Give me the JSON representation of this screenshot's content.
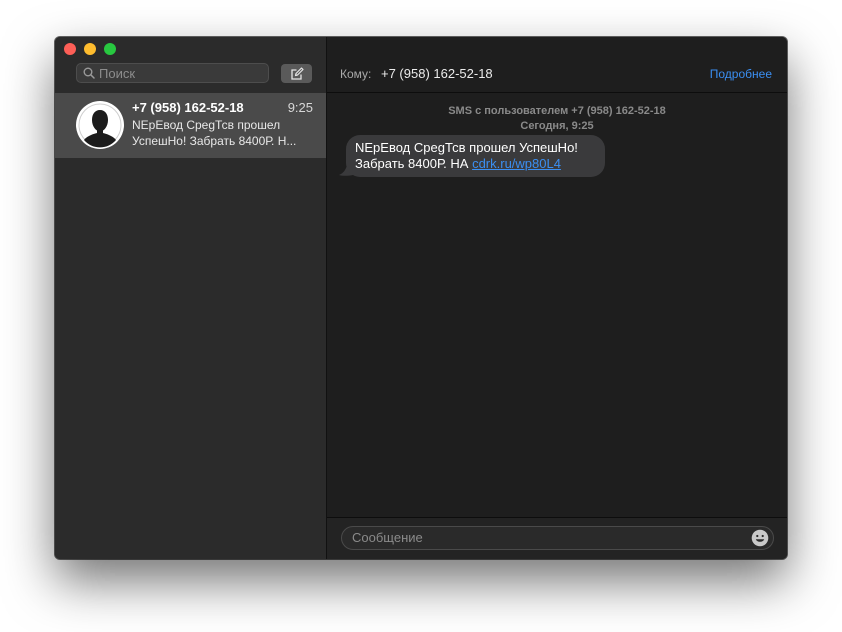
{
  "sidebar": {
    "search": {
      "placeholder": "Поиск"
    },
    "conversations": [
      {
        "name": "+7 (958) 162-52-18",
        "time": "9:25",
        "preview": "NEpЕвод СрegТсв прошел УспешНо! Забрать 8400Р. Н..."
      }
    ]
  },
  "main": {
    "to_label": "Кому:",
    "to_value": "+7 (958) 162-52-18",
    "details_label": "Подробнее",
    "thread_info_line1": "SMS с пользователем +7 (958) 162-52-18",
    "thread_info_line2": "Сегодня, 9:25",
    "message": {
      "text": "NEpЕвод СрegТсв прошел УспешНо! Забрать 8400Р. НА ",
      "link": "cdrk.ru/wp80L4"
    },
    "composer_placeholder": "Сообщение"
  },
  "colors": {
    "accent": "#3b8ff2",
    "selected_row": "#4a4a4a",
    "bubble": "#3a3a3c"
  },
  "icons": [
    "search-icon",
    "compose-icon",
    "avatar-placeholder-icon",
    "emoji-icon"
  ]
}
